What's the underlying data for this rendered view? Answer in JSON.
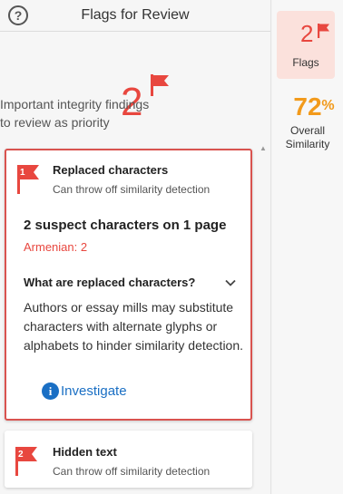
{
  "header": {
    "title": "Flags for Review",
    "help_icon": "question-circle-icon"
  },
  "summary": {
    "count": "2",
    "description_line1": "Important integrity findings",
    "description_line2": "to review as priority"
  },
  "cards": [
    {
      "number": "1",
      "title": "Replaced characters",
      "subtitle": "Can throw off similarity detection",
      "headline": "2 suspect characters on 1 page",
      "detail": "Armenian: 2",
      "faq_question": "What are replaced characters?",
      "faq_answer": "Authors or essay mills may substitute characters with alternate glyphs or alphabets to hinder similarity detection.",
      "action_label": "Investigate"
    },
    {
      "number": "2",
      "title": "Hidden text",
      "subtitle": "Can throw off similarity detection"
    }
  ],
  "rail": {
    "flags_count": "2",
    "flags_label": "Flags",
    "similarity_value": "72",
    "similarity_unit": "%",
    "similarity_label_line1": "Overall",
    "similarity_label_line2": "Similarity"
  },
  "colors": {
    "flag_red": "#e8473f",
    "similarity_orange": "#f29a1b",
    "link_blue": "#1a6fc4",
    "active_border": "#d9534f"
  }
}
